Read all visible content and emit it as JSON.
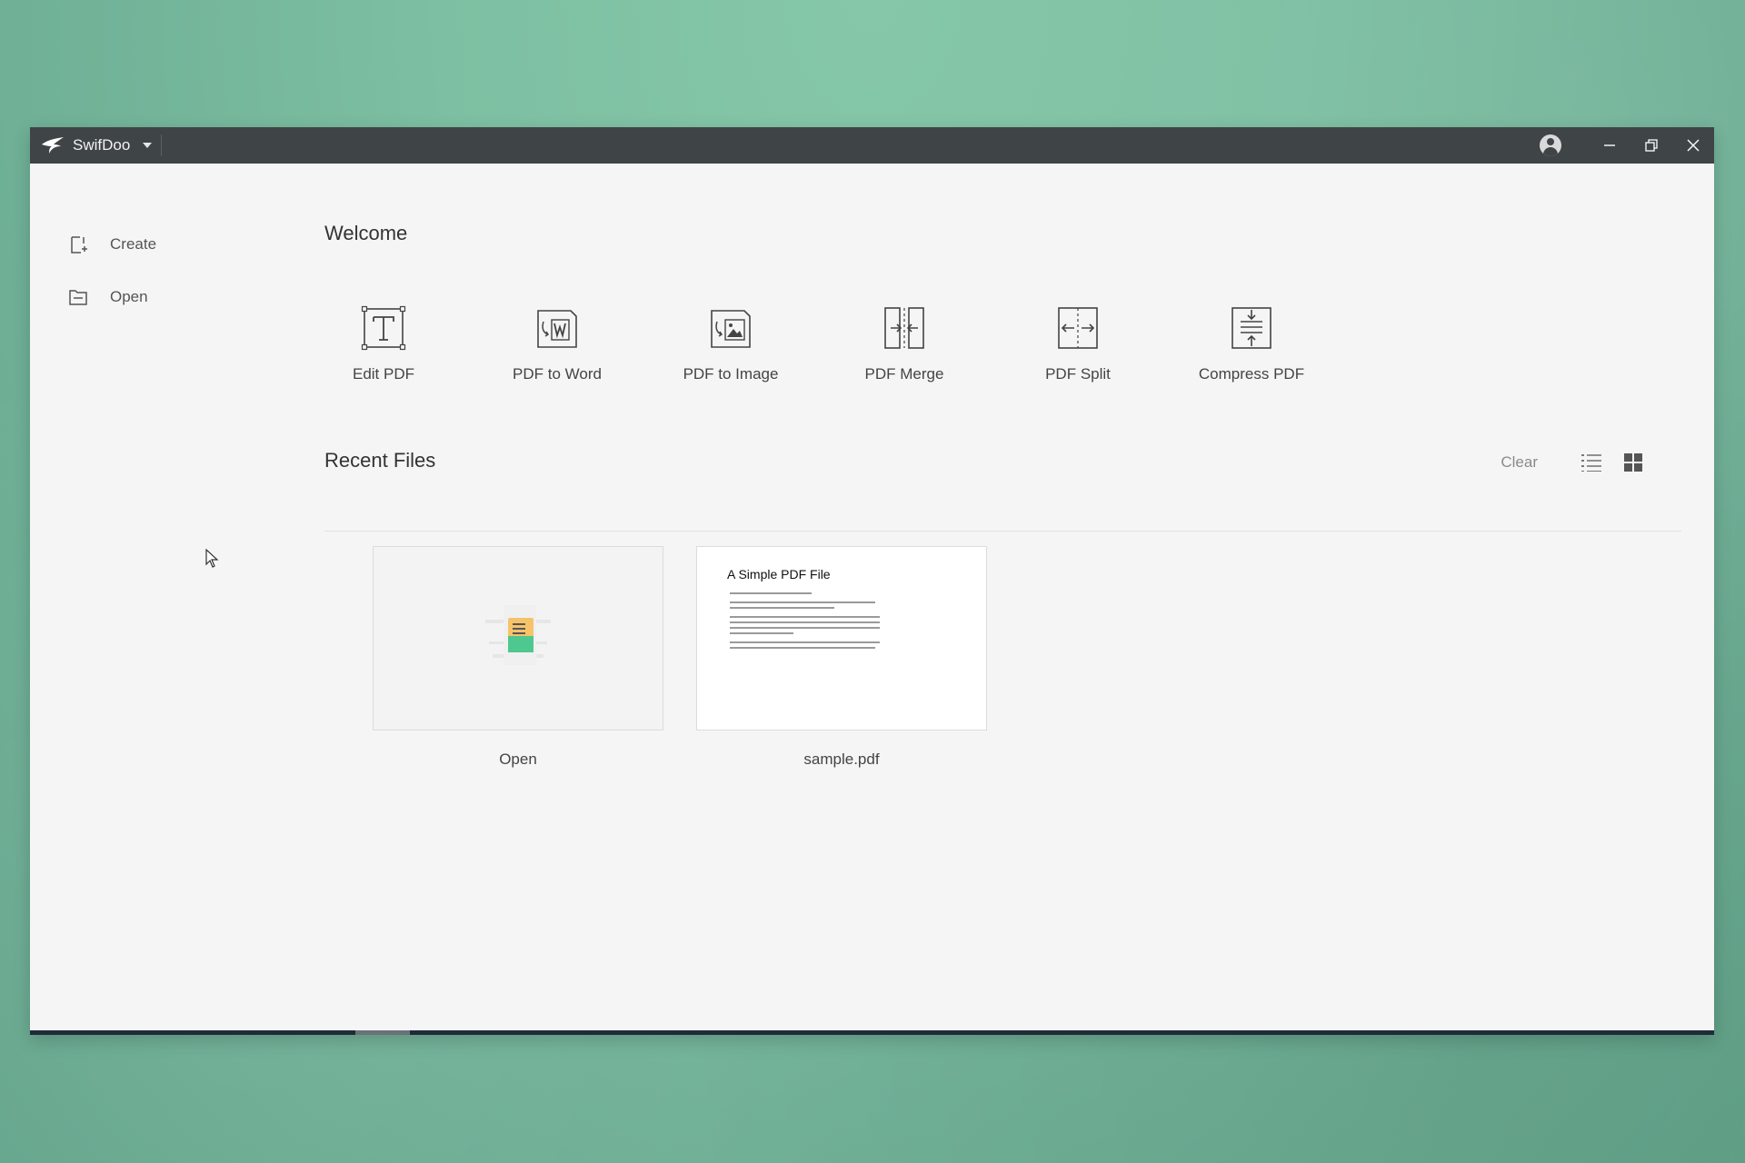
{
  "app": {
    "name": "SwifDoo",
    "accent": "#3f4447"
  },
  "sidebar": {
    "items": [
      {
        "label": "Create",
        "icon": "create-file-icon"
      },
      {
        "label": "Open",
        "icon": "folder-open-icon"
      }
    ]
  },
  "main": {
    "welcome": "Welcome",
    "tools": [
      {
        "label": "Edit PDF",
        "icon": "edit-text-icon"
      },
      {
        "label": "PDF to Word",
        "icon": "word-convert-icon"
      },
      {
        "label": "PDF to Image",
        "icon": "image-convert-icon"
      },
      {
        "label": "PDF Merge",
        "icon": "merge-icon"
      },
      {
        "label": "PDF Split",
        "icon": "split-icon"
      },
      {
        "label": "Compress PDF",
        "icon": "compress-icon"
      }
    ],
    "recent": {
      "title": "Recent Files",
      "clear_label": "Clear",
      "view_list_icon": "list-view-icon",
      "view_grid_icon": "grid-view-icon",
      "files": [
        {
          "label": "Open",
          "icon": "open-file-illustration-icon"
        },
        {
          "label": "sample.pdf",
          "preview_title": "A Simple PDF File"
        }
      ]
    }
  }
}
